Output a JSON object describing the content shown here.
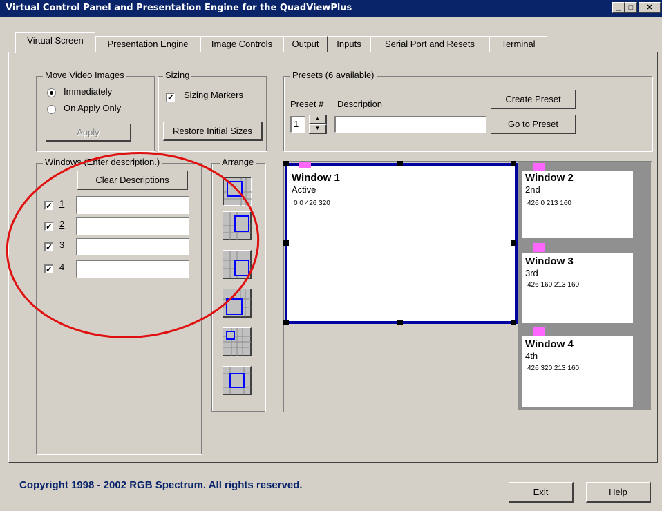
{
  "window": {
    "title": "Virtual Control Panel and Presentation Engine for the QuadViewPlus",
    "min_label": "_",
    "max_label": "□",
    "close_label": "✕"
  },
  "tabs": [
    {
      "label": "Virtual Screen",
      "active": true
    },
    {
      "label": "Presentation Engine"
    },
    {
      "label": "Image Controls"
    },
    {
      "label": "Output"
    },
    {
      "label": "Inputs"
    },
    {
      "label": "Serial Port and Resets"
    },
    {
      "label": "Terminal"
    }
  ],
  "move_video": {
    "legend": "Move Video Images",
    "opt_immediately": "Immediately",
    "opt_on_apply": "On Apply Only",
    "selected": "Immediately",
    "apply_label": "Apply"
  },
  "sizing": {
    "legend": "Sizing",
    "markers_label": "Sizing Markers",
    "markers_checked": true,
    "restore_label": "Restore Initial Sizes"
  },
  "presets": {
    "legend": "Presets (6 available)",
    "preset_label": "Preset #",
    "description_label": "Description",
    "preset_value": "1",
    "description_value": "",
    "create_label": "Create Preset",
    "goto_label": "Go to Preset"
  },
  "windows_group": {
    "legend": "Windows (Enter description.)",
    "clear_label": "Clear Descriptions",
    "rows": [
      {
        "num": "1",
        "checked": true,
        "value": ""
      },
      {
        "num": "2",
        "checked": true,
        "value": ""
      },
      {
        "num": "3",
        "checked": true,
        "value": ""
      },
      {
        "num": "4",
        "checked": true,
        "value": ""
      }
    ]
  },
  "arrange": {
    "legend": "Arrange",
    "buttons": [
      "layout-1",
      "layout-2",
      "layout-3",
      "layout-4",
      "layout-5",
      "layout-6"
    ]
  },
  "screen": {
    "windows": [
      {
        "title": "Window 1",
        "sub": "Active",
        "coords": "0 0 426 320"
      },
      {
        "title": "Window 2",
        "sub": "2nd",
        "coords": "426 0 213 160"
      },
      {
        "title": "Window 3",
        "sub": "3rd",
        "coords": "426 160 213 160"
      },
      {
        "title": "Window 4",
        "sub": "4th",
        "coords": "426 320 213 160"
      }
    ],
    "accent_color": "#0000a0",
    "marker_color": "#ff66ff"
  },
  "footer": {
    "copyright": "Copyright 1998 - 2002 RGB Spectrum.  All rights reserved.",
    "exit_label": "Exit",
    "help_label": "Help"
  },
  "annotation": {
    "color": "#e01010"
  }
}
